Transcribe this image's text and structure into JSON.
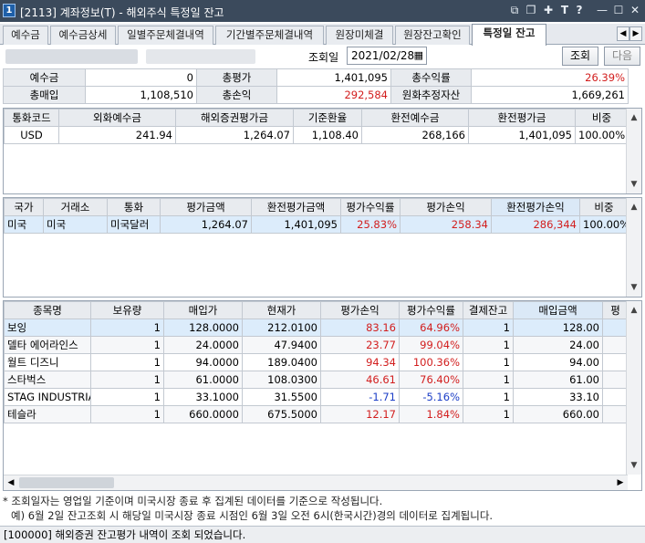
{
  "window": {
    "number": "1",
    "title": "[2113] 계좌정보(T) - 해외주식 특정일 잔고",
    "icons": [
      "restore-window-icon",
      "copy-window-icon",
      "pin-icon",
      "font-icon",
      "help-icon",
      "minimize-icon",
      "maximize-icon",
      "close-icon"
    ]
  },
  "tabs": [
    "예수금",
    "예수금상세",
    "일별주문체결내역",
    "기간별주문체결내역",
    "원장미체결",
    "원장잔고확인",
    "특정일 잔고"
  ],
  "active_tab": "특정일 잔고",
  "query": {
    "date_label": "조회일",
    "date_value": "2021/02/28",
    "query_button": "조회",
    "next_button": "다음"
  },
  "summary": {
    "r1": [
      "예수금",
      "0",
      "총평가",
      "1,401,095",
      "총수익률",
      "26.39%"
    ],
    "r2": [
      "총매입",
      "1,108,510",
      "총손익",
      "292,584",
      "원화추정자산",
      "1,669,261"
    ]
  },
  "currency_table": {
    "headers": [
      "통화코드",
      "외화예수금",
      "해외증권평가금",
      "기준환율",
      "환전예수금",
      "환전평가금",
      "비중"
    ],
    "rows": [
      [
        "USD",
        "241.94",
        "1,264.07",
        "1,108.40",
        "268,166",
        "1,401,095",
        "100.00%"
      ]
    ]
  },
  "country_table": {
    "headers": [
      "국가",
      "거래소",
      "통화",
      "평가금액",
      "환전평가금액",
      "평가수익률",
      "평가손익",
      "환전평가손익",
      "비중"
    ],
    "rows": [
      [
        "미국",
        "미국",
        "미국달러",
        "1,264.07",
        "1,401,095",
        "25.83%",
        "258.34",
        "286,344",
        "100.00%"
      ]
    ]
  },
  "holdings_table": {
    "headers": [
      "종목명",
      "보유량",
      "매입가",
      "현재가",
      "평가손익",
      "평가수익률",
      "결제잔고",
      "매입금액",
      "평"
    ],
    "rows": [
      [
        "보잉",
        "1",
        "128.0000",
        "212.0100",
        "83.16",
        "64.96%",
        "1",
        "128.00"
      ],
      [
        "델타 에어라인스",
        "1",
        "24.0000",
        "47.9400",
        "23.77",
        "99.04%",
        "1",
        "24.00"
      ],
      [
        "월트 디즈니",
        "1",
        "94.0000",
        "189.0400",
        "94.34",
        "100.36%",
        "1",
        "94.00"
      ],
      [
        "스타벅스",
        "1",
        "61.0000",
        "108.0300",
        "46.61",
        "76.40%",
        "1",
        "61.00"
      ],
      [
        "STAG INDUSTRIAL",
        "1",
        "33.1000",
        "31.5500",
        "-1.71",
        "-5.16%",
        "1",
        "33.10"
      ],
      [
        "테슬라",
        "1",
        "660.0000",
        "675.5000",
        "12.17",
        "1.84%",
        "1",
        "660.00"
      ]
    ]
  },
  "notes": {
    "line1": "* 조회일자는 영업일 기준이며 미국시장 종료 후 집계된 데이터를 기준으로 작성됩니다.",
    "line2": "예) 6월 2일 잔고조회 시 해당일 미국시장 종료 시점인 6월 3일 오전 6시(한국시간)경의 데이터로 집계됩니다."
  },
  "status": "[100000] 해외증권 잔고평가 내역이 조회 되었습니다.",
  "colors": {
    "profit": "#d21e1e",
    "loss": "#1d3fc7",
    "selected_row": "#dcecfb",
    "titlebar": "#3b4a5c"
  }
}
